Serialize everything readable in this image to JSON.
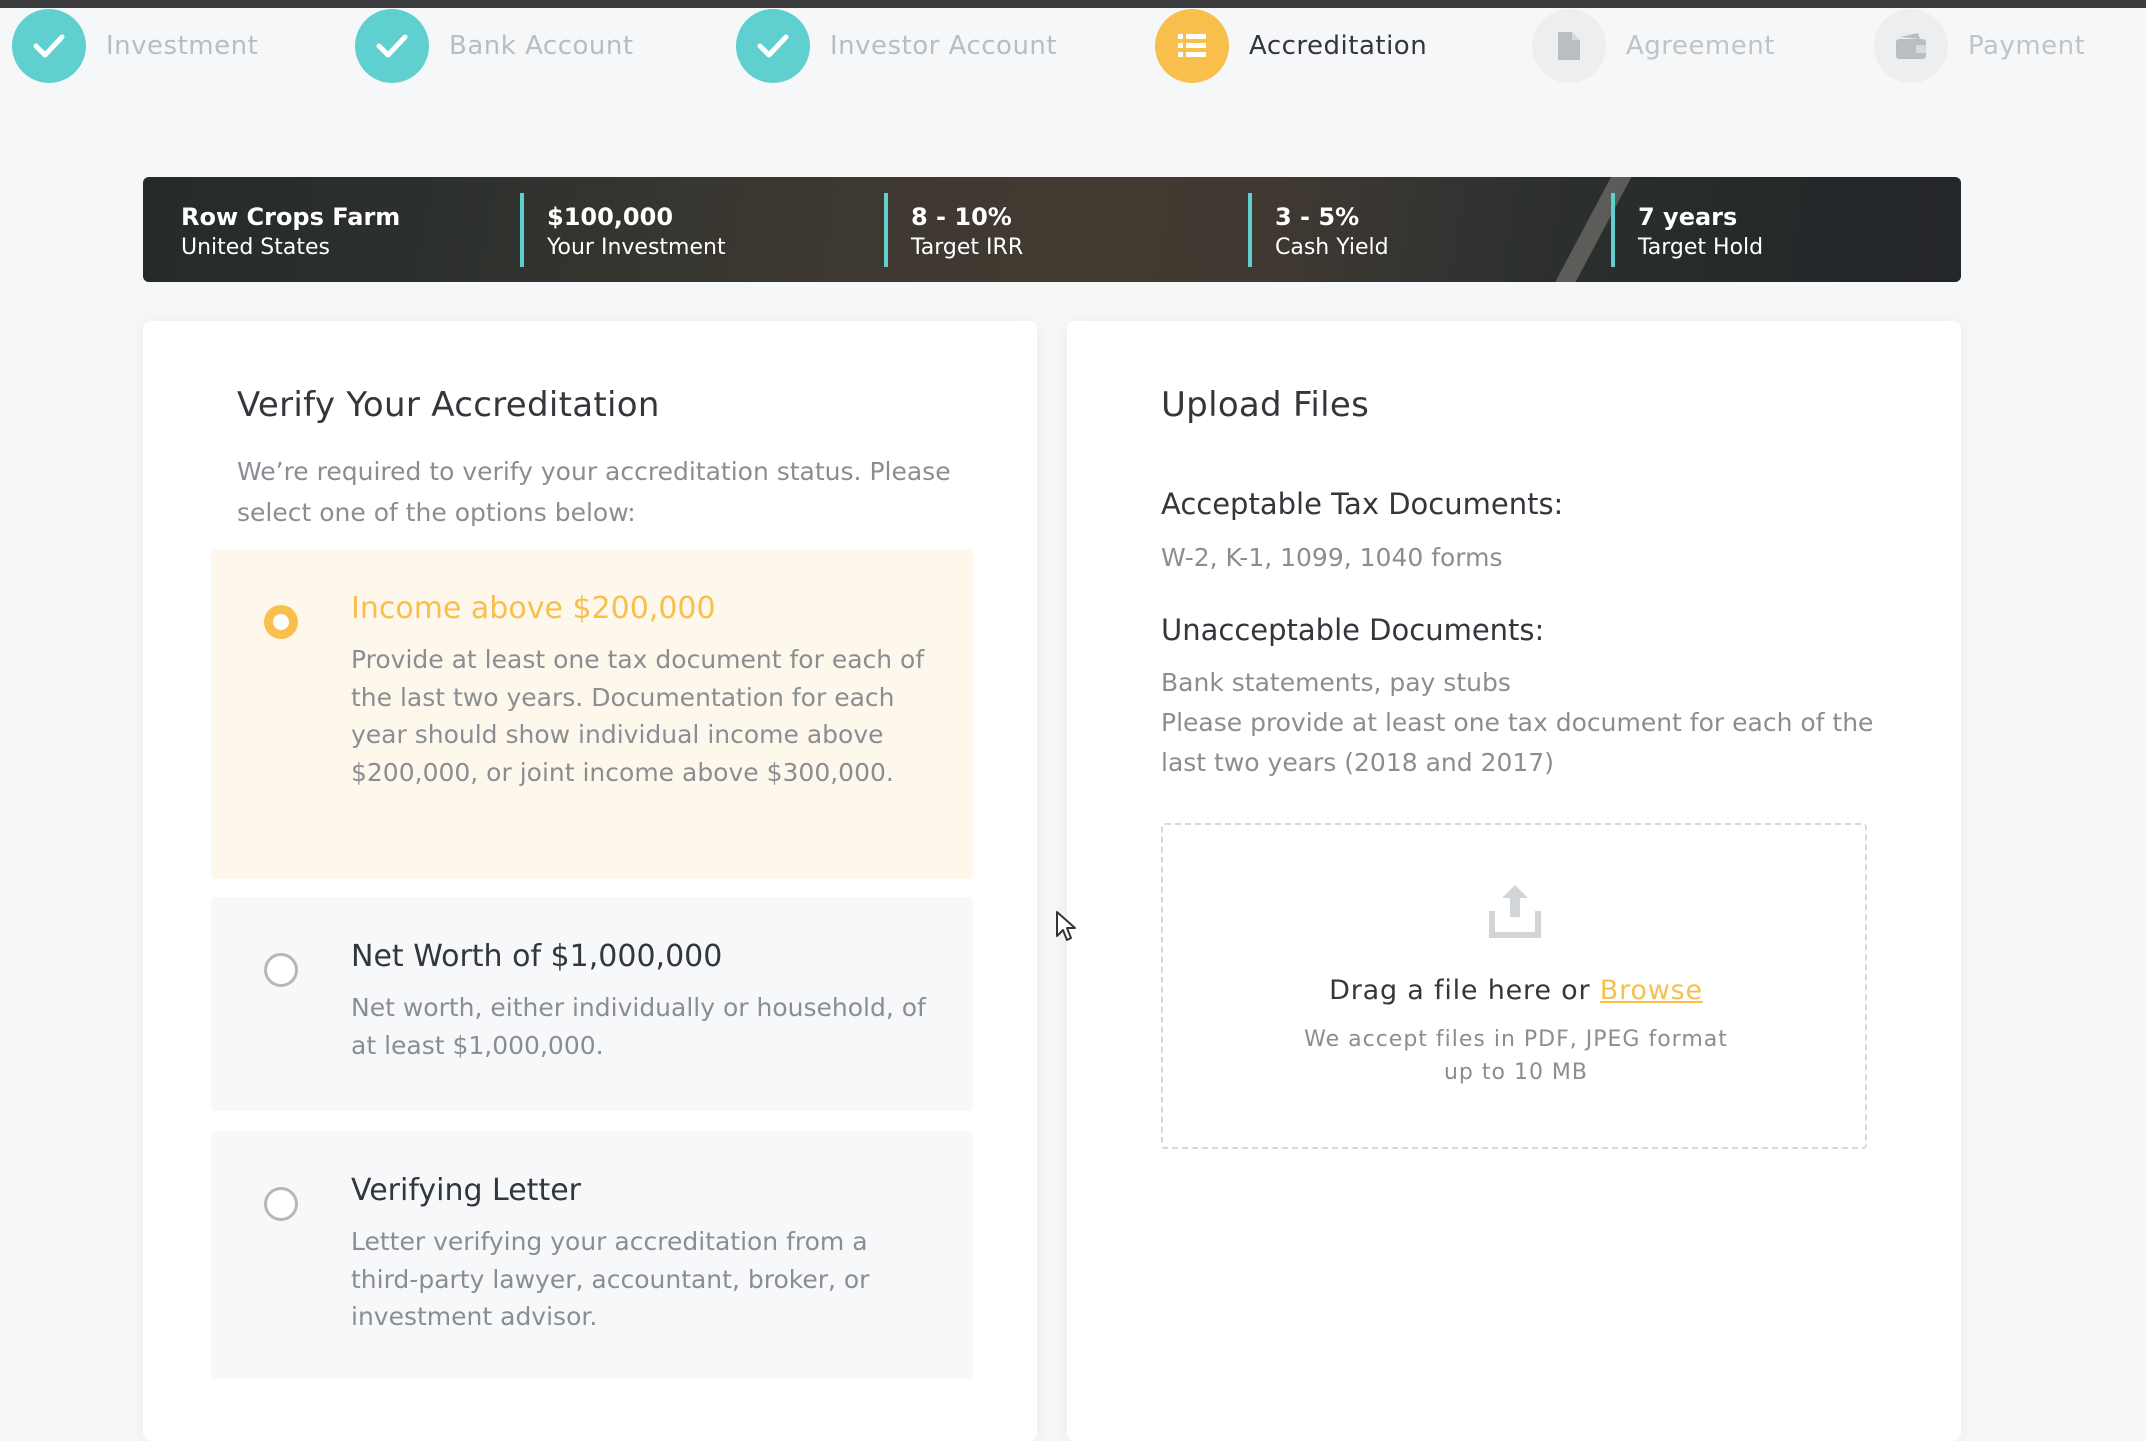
{
  "stepper": {
    "steps": [
      {
        "label": "Investment",
        "state": "done",
        "icon": "check-icon"
      },
      {
        "label": "Bank Account",
        "state": "done",
        "icon": "check-icon"
      },
      {
        "label": "Investor Account",
        "state": "done",
        "icon": "check-icon"
      },
      {
        "label": "Accreditation",
        "state": "active",
        "icon": "list-icon"
      },
      {
        "label": "Agreement",
        "state": "todo",
        "icon": "document-icon"
      },
      {
        "label": "Payment",
        "state": "todo",
        "icon": "wallet-icon"
      }
    ]
  },
  "banner": {
    "items": [
      {
        "value": "Row Crops Farm",
        "label": "United States"
      },
      {
        "value": "$100,000",
        "label": "Your Investment"
      },
      {
        "value": "8 - 10%",
        "label": "Target IRR"
      },
      {
        "value": "3 - 5%",
        "label": "Cash Yield"
      },
      {
        "value": "7 years",
        "label": "Target Hold"
      }
    ]
  },
  "verify": {
    "title": "Verify Your Accreditation",
    "intro": "We’re required to verify your accreditation status. Please select one of the options below:",
    "options": [
      {
        "title": "Income above $200,000",
        "description": "Provide at least one tax document for each of the last two years. Documentation for each year should show individual income above $200,000, or joint income above $300,000.",
        "selected": true
      },
      {
        "title": "Net Worth of $1,000,000",
        "description": "Net worth, either individually or household, of at least $1,000,000.",
        "selected": false
      },
      {
        "title": "Verifying Letter",
        "description": "Letter verifying your accreditation from a third-party lawyer, accountant, broker, or investment advisor.",
        "selected": false
      }
    ]
  },
  "upload": {
    "title": "Upload Files",
    "acceptable_title": "Acceptable Tax Documents:",
    "acceptable_text": "W-2, K-1, 1099, 1040 forms",
    "unacceptable_title": "Unacceptable Documents:",
    "unacceptable_text": "Bank statements, pay stubs",
    "note": "Please provide at least one tax document for each of the last two years (2018 and 2017)",
    "drag_text": "Drag a file here or",
    "browse_label": "Browse",
    "accept_line1": "We accept files in PDF, JPEG format",
    "accept_line2": "up to 10 MB"
  },
  "colors": {
    "accent": "#f9bf4d",
    "done": "#5fd0cf",
    "text": "#33363a",
    "muted": "#8a8e92"
  }
}
